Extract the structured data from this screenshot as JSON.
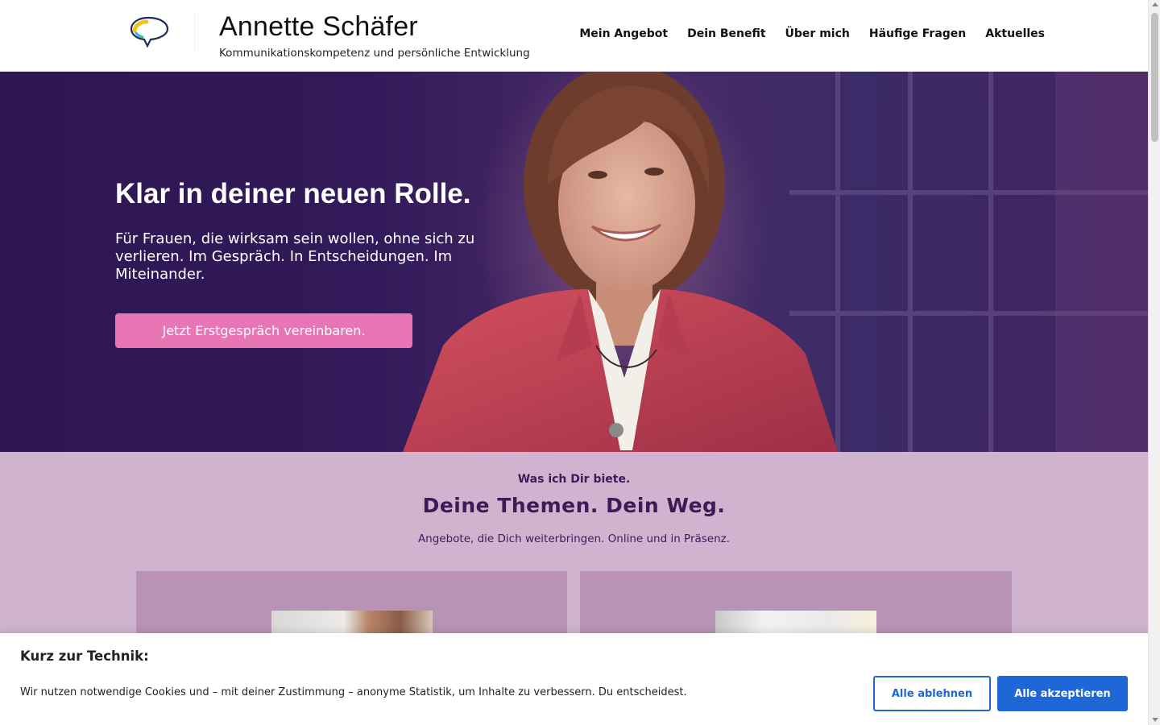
{
  "header": {
    "brand_title": "Annette Schäfer",
    "brand_tagline": "Kommunikationskompetenz und persönliche Entwicklung",
    "logo_icon": "speech-bubble-icon",
    "nav": [
      {
        "label": "Mein Angebot"
      },
      {
        "label": "Dein Benefit"
      },
      {
        "label": "Über mich"
      },
      {
        "label": "Häufige Fragen"
      },
      {
        "label": "Aktuelles"
      }
    ]
  },
  "hero": {
    "title": "Klar in deiner neuen Rolle.",
    "subtitle": "Für Frauen, die wirksam sein wollen, ohne sich zu verlieren. Im Gespräch. In Entscheidungen. Im Miteinander.",
    "cta_label": "Jetzt Erstgespräch vereinbaren."
  },
  "offers": {
    "kicker": "Was ich Dir biete.",
    "heading": "Deine Themen. Dein Weg.",
    "lead": "Angebote, die Dich weiterbringen. Online und in Präsenz."
  },
  "cookie_banner": {
    "title": "Kurz zur Technik:",
    "text": "Wir nutzen notwendige Cookies und – mit deiner Zustimmung – anonyme Statistik, um Inhalte zu verbessern. Du entscheidest.",
    "reject_label": "Alle ablehnen",
    "accept_label": "Alle akzeptieren"
  },
  "colors": {
    "hero_bg": "#321a5a",
    "cta": "#e876b5",
    "section_bg": "#d0b4cf",
    "card_bg": "#b893b5",
    "heading_purple": "#3d1a58",
    "cookie_blue": "#1f66d6"
  }
}
